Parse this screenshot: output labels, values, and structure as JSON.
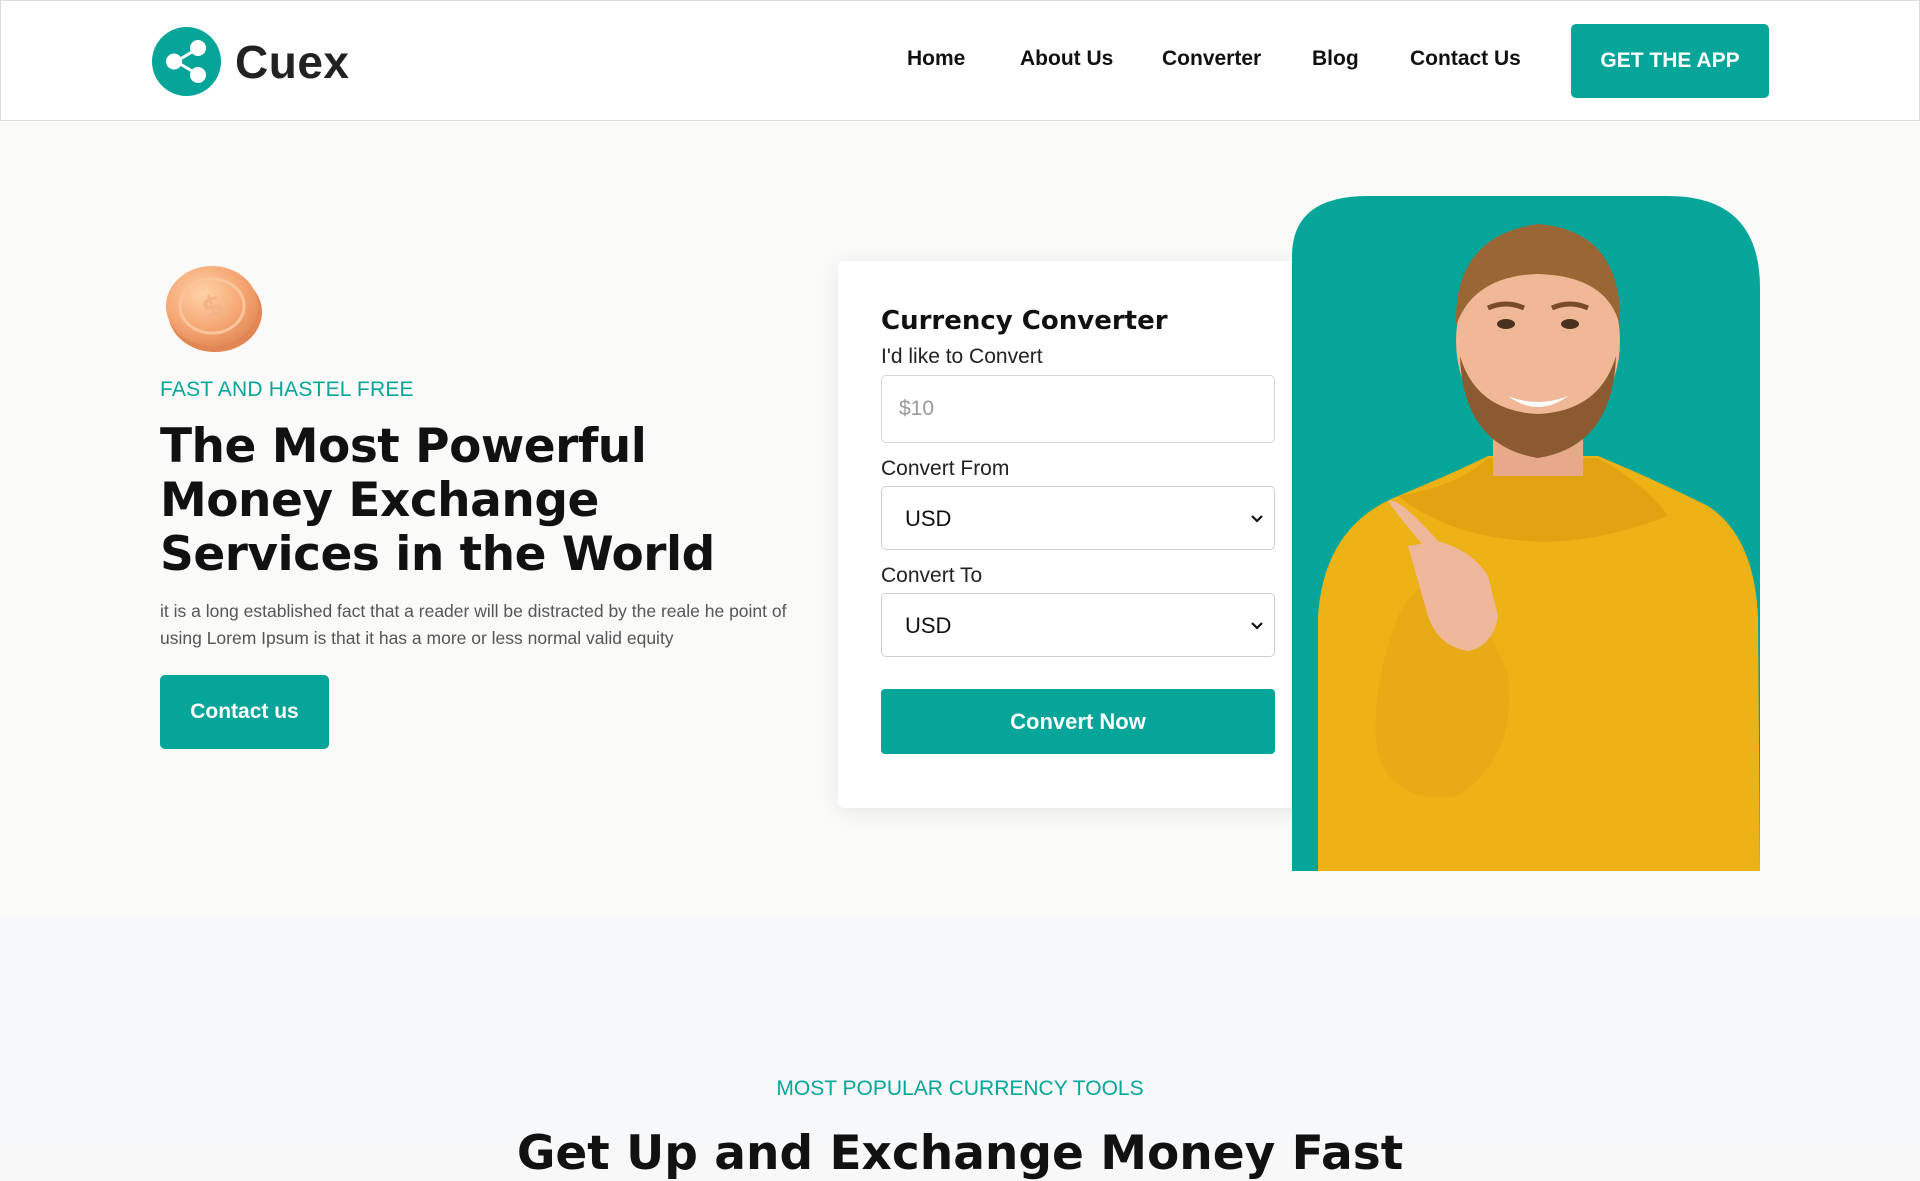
{
  "brand": {
    "name": "Cuex",
    "accent": "#05a59a"
  },
  "nav": {
    "items": [
      {
        "label": "Home"
      },
      {
        "label": "About Us"
      },
      {
        "label": "Converter"
      },
      {
        "label": "Blog"
      },
      {
        "label": "Contact Us"
      }
    ],
    "cta_label": "GET THE APP"
  },
  "hero": {
    "icon": "dollar-coin-icon",
    "eyebrow": "FAST AND HASTEL FREE",
    "title": "The Most Powerful Money Exchange Services in the World",
    "description": "it is a long established fact that a reader will be distracted by the reale he point of using Lorem Ipsum is that it has a more or less normal valid equity",
    "button_label": "Contact us"
  },
  "converter": {
    "title": "Currency Converter",
    "amount_label": "I'd like to Convert",
    "amount_placeholder": "$10",
    "from_label": "Convert From",
    "from_value": "USD",
    "to_label": "Convert To",
    "to_value": "USD",
    "button_label": "Convert Now"
  },
  "section2": {
    "eyebrow": "MOST POPULAR CURRENCY TOOLS",
    "title": "Get Up and Exchange Money Fast"
  }
}
